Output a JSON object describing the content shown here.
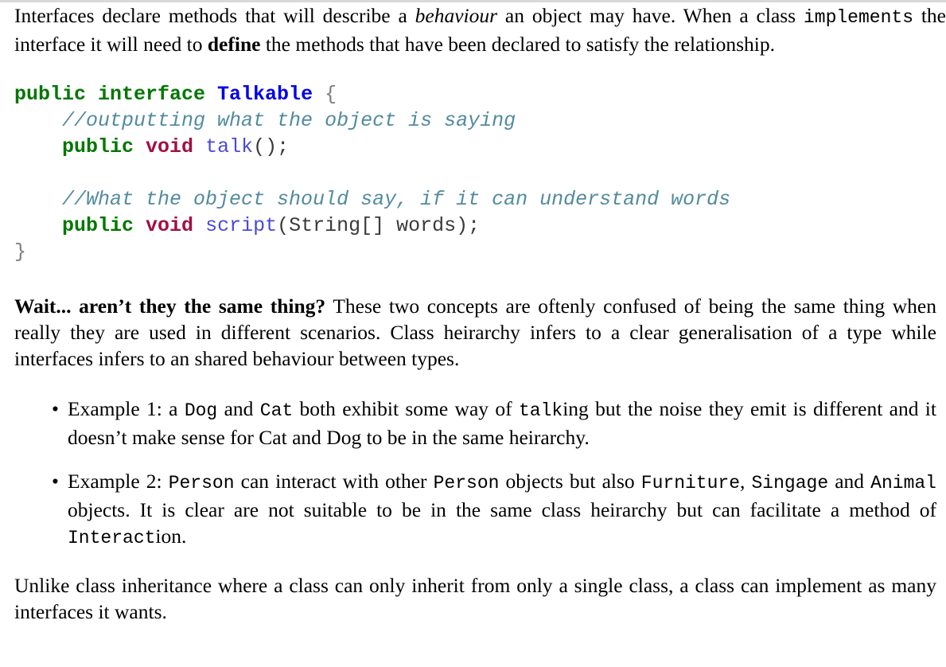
{
  "document": {
    "paragraph_1": {
      "segment_1": "Interfaces declare methods that will describe a ",
      "emphasis_behaviour": "behaviour",
      "segment_2": " an object may have. When a class ",
      "code_implements": "implements",
      "segment_3": " the interface it will need to ",
      "strong_define": "define",
      "segment_4": " the methods that have been declared to satisfy the relationship."
    },
    "code_listing": {
      "language": "java",
      "lines": [
        {
          "id": "line-1",
          "tokens": [
            {
              "text": "public interface ",
              "kind": "keyword"
            },
            {
              "text": "Talkable",
              "kind": "type"
            },
            {
              "text": " {",
              "kind": "punct"
            }
          ]
        },
        {
          "id": "line-2",
          "tokens": [
            {
              "text": "    //outputting what the object is saying",
              "kind": "comment"
            }
          ]
        },
        {
          "id": "line-3",
          "tokens": [
            {
              "text": "    public ",
              "kind": "keyword"
            },
            {
              "text": "void",
              "kind": "return-type"
            },
            {
              "text": " ",
              "kind": "plain"
            },
            {
              "text": "talk",
              "kind": "method"
            },
            {
              "text": "();",
              "kind": "plain"
            }
          ]
        },
        {
          "id": "line-4",
          "tokens": [
            {
              "text": "",
              "kind": "plain"
            }
          ]
        },
        {
          "id": "line-5",
          "tokens": [
            {
              "text": "    //What the object should say, if it can understand words",
              "kind": "comment"
            }
          ]
        },
        {
          "id": "line-6",
          "tokens": [
            {
              "text": "    public ",
              "kind": "keyword"
            },
            {
              "text": "void",
              "kind": "return-type"
            },
            {
              "text": " ",
              "kind": "plain"
            },
            {
              "text": "script",
              "kind": "method"
            },
            {
              "text": "(String[] words);",
              "kind": "plain"
            }
          ]
        },
        {
          "id": "line-7",
          "tokens": [
            {
              "text": "}",
              "kind": "punct"
            }
          ]
        }
      ]
    },
    "paragraph_2": {
      "lead_in": "Wait...  aren’t they the same thing?",
      "body": "  These two concepts are oftenly confused of being the same thing when really they are used in different scenarios. Class heirarchy infers to a clear generalisation of a type while interfaces infers to an shared behaviour between types."
    },
    "examples": {
      "bullet_glyph": "•",
      "items": [
        {
          "id": "example-1",
          "parts": [
            {
              "text": "Example 1: a ",
              "kind": "prose"
            },
            {
              "text": "Dog",
              "kind": "code"
            },
            {
              "text": " and ",
              "kind": "prose"
            },
            {
              "text": "Cat",
              "kind": "code"
            },
            {
              "text": " both exhibit some way of ",
              "kind": "prose"
            },
            {
              "text": "talk",
              "kind": "code"
            },
            {
              "text": "ing but the noise they emit is different and it doesn’t make sense for Cat and Dog to be in the same heirarchy.",
              "kind": "prose"
            }
          ]
        },
        {
          "id": "example-2",
          "parts": [
            {
              "text": "Example 2: ",
              "kind": "prose"
            },
            {
              "text": "Person",
              "kind": "code"
            },
            {
              "text": " can interact with other ",
              "kind": "prose"
            },
            {
              "text": "Person",
              "kind": "code"
            },
            {
              "text": " objects but also ",
              "kind": "prose"
            },
            {
              "text": "Furniture",
              "kind": "code"
            },
            {
              "text": ", ",
              "kind": "prose"
            },
            {
              "text": "Singage",
              "kind": "code"
            },
            {
              "text": " and ",
              "kind": "prose"
            },
            {
              "text": "Animal",
              "kind": "code"
            },
            {
              "text": " objects.  It is clear are not suitable to be in the same class heirarchy but can facilitate a method of ",
              "kind": "prose"
            },
            {
              "text": "Interact",
              "kind": "code"
            },
            {
              "text": "ion.",
              "kind": "prose"
            }
          ]
        }
      ]
    },
    "paragraph_3": {
      "text": "Unlike class inheritance where a class can only inherit from only a single class, a class can implement as many interfaces it wants."
    }
  },
  "colors": {
    "page_background": "#ffffff",
    "text": "#000000",
    "top_rule": "#d8d8d8",
    "code_keyword": "#007700",
    "code_type": "#0000e6",
    "code_return_type": "#a2103f",
    "code_method": "#4a4ad6",
    "code_comment": "#528b9e",
    "code_punct": "#7d7d7d",
    "code_plain": "#3a3a3a"
  }
}
